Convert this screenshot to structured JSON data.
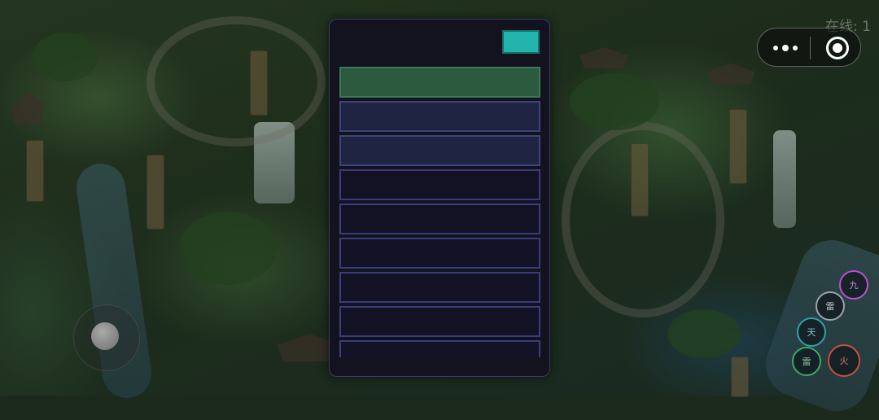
{
  "hud": {
    "online_text": "在线: 1"
  },
  "panel": {
    "close_button_color": "#22b3ac",
    "rows": [
      {
        "text": "",
        "state": "active"
      },
      {
        "text": "",
        "state": "highlight"
      },
      {
        "text": "",
        "state": "highlight"
      },
      {
        "text": "",
        "state": "normal"
      },
      {
        "text": "",
        "state": "normal"
      },
      {
        "text": "",
        "state": "normal"
      },
      {
        "text": "",
        "state": "normal"
      },
      {
        "text": "",
        "state": "normal"
      },
      {
        "text": "",
        "state": "normal"
      }
    ]
  },
  "skills": {
    "jiu": "九",
    "lei_top": "雷",
    "tian": "天",
    "lei_bottom": "雷",
    "huo": "火"
  },
  "colors": {
    "skill_jiu": "#b94fd0",
    "skill_lei_top": "#9aa3b0",
    "skill_tian": "#2fa2a8",
    "skill_lei_bottom": "#3ea66a",
    "skill_huo": "#c9503f"
  }
}
